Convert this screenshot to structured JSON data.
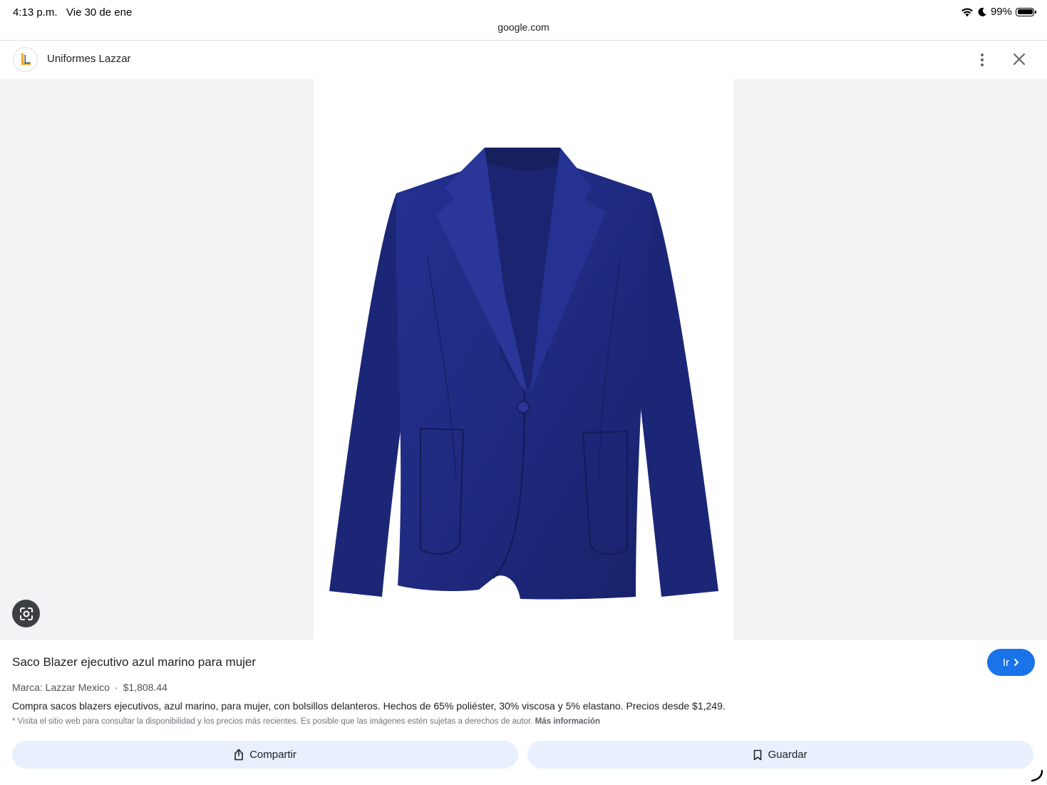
{
  "status_bar": {
    "time": "4:13 p.m.",
    "date": "Vie 30 de ene",
    "battery": "99%",
    "icons": [
      "wifi-icon",
      "moon-icon",
      "battery-icon"
    ]
  },
  "browser": {
    "url": "google.com"
  },
  "header": {
    "site_name": "Uniformes Lazzar",
    "logo_letter": "L",
    "menu_icon": "more-vert-icon",
    "close_icon": "close-icon"
  },
  "image": {
    "subject": "navy blue women's blazer",
    "lens_icon": "google-lens-icon"
  },
  "product": {
    "title": "Saco Blazer ejecutivo azul marino para mujer",
    "go_label": "Ir",
    "brand": "Marca: Lazzar Mexico",
    "separator": "·",
    "price": "$1,808.44",
    "description": "Compra sacos blazers ejecutivos, azul marino, para mujer, con bolsillos delanteros. Hechos de 65% poliéster, 30% viscosa y 5% elastano. Precios desde $1,249.",
    "disclaimer": "* Visita el sitio web para consultar la disponibilidad y los precios más recientes. Es posible que las imágenes estén sujetas a derechos de autor.",
    "more_info": "Más información"
  },
  "actions": {
    "share_label": "Compartir",
    "save_label": "Guardar"
  },
  "colors": {
    "accent": "#1a73e8",
    "action_bg": "#e8f0fe",
    "image_bg": "#f1f3f4",
    "blazer": "#1f2a7a",
    "logo_orange": "#f5a623"
  }
}
